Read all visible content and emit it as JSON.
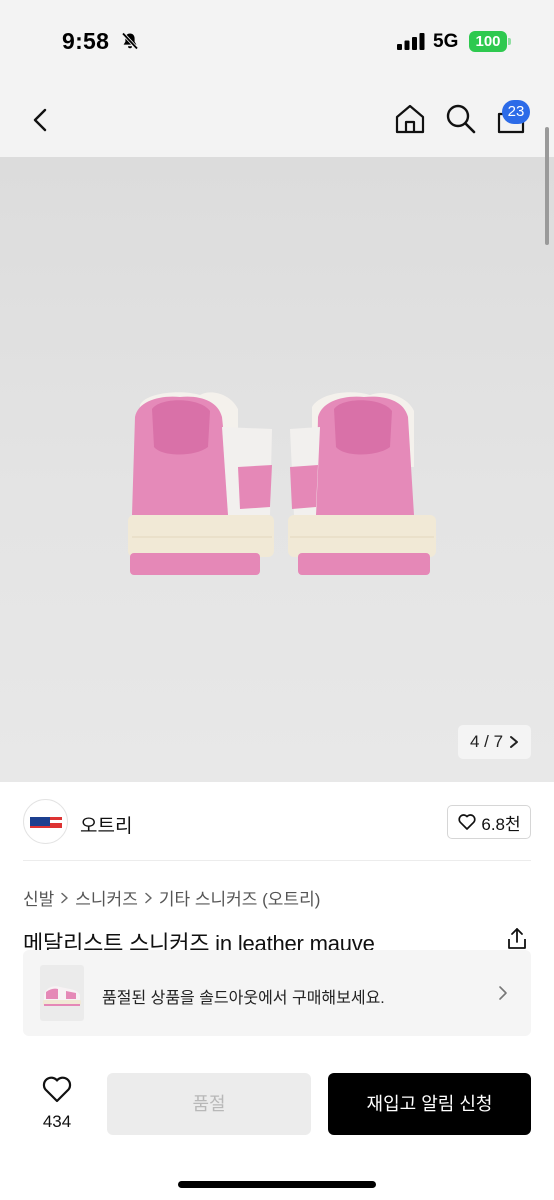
{
  "status_bar": {
    "time": "9:58",
    "network": "5G",
    "battery": "100",
    "icons": [
      "bell-muted-icon",
      "signal-icon"
    ]
  },
  "nav": {
    "icons": [
      "back-icon",
      "home-icon",
      "search-icon",
      "shopping-bag-icon"
    ],
    "cart_count": "23",
    "badge_color": "#2c6be8"
  },
  "gallery": {
    "counter": "4 / 7",
    "current_index": 4,
    "total": 7
  },
  "brand": {
    "name": "오트리",
    "likes": "6.8천"
  },
  "breadcrumb": [
    "신발",
    "스니커즈",
    "기타 스니커즈 (오트리)"
  ],
  "product": {
    "title": "메달리스트 스니커즈 in leather mauve"
  },
  "soldout_banner": {
    "text": "품절된 상품을 솔드아웃에서 구매해보세요."
  },
  "bottom_bar": {
    "wish_count": "434",
    "soldout_label": "품절",
    "restock_label": "재입고 알림 신청"
  },
  "colors": {
    "accent": "#000000",
    "battery": "#2ec94f",
    "shoe_pink": "#e88bbd"
  }
}
